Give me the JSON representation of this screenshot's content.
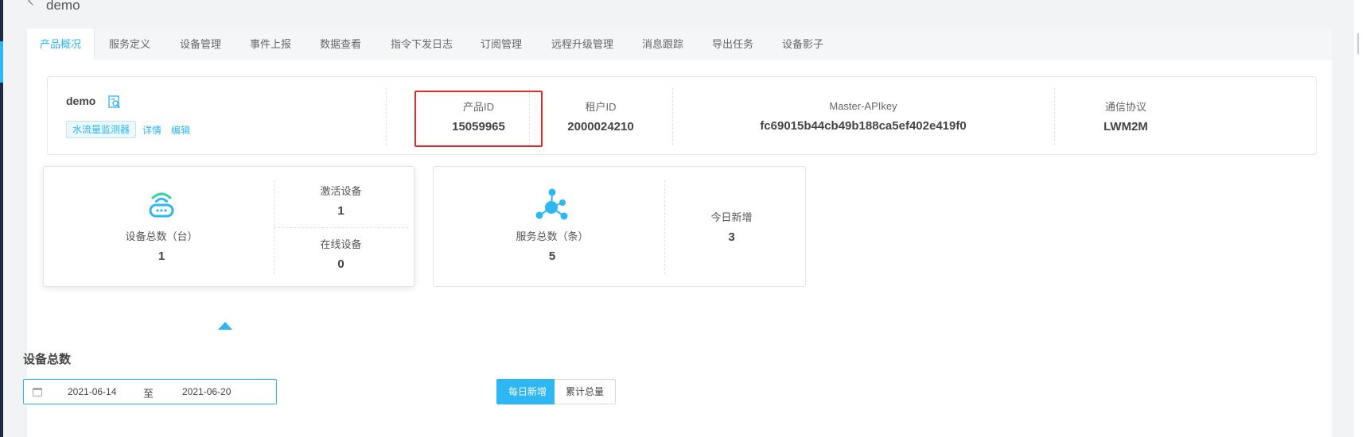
{
  "header": {
    "back_icon": "chevron-left-icon",
    "title": "demo"
  },
  "tabs": [
    {
      "label": "产品概况",
      "active": true
    },
    {
      "label": "服务定义"
    },
    {
      "label": "设备管理"
    },
    {
      "label": "事件上报"
    },
    {
      "label": "数据查看"
    },
    {
      "label": "指令下发日志"
    },
    {
      "label": "订阅管理"
    },
    {
      "label": "远程升级管理"
    },
    {
      "label": "消息跟踪"
    },
    {
      "label": "导出任务"
    },
    {
      "label": "设备影子"
    }
  ],
  "product": {
    "name": "demo",
    "name_icon": "document-search-icon",
    "tag": "水流量监测器",
    "detail_link": "详情",
    "edit_link": "编辑",
    "product_id_label": "产品ID",
    "product_id": "15059965",
    "tenant_id_label": "租户ID",
    "tenant_id": "2000024210",
    "apikey_label": "Master-APIkey",
    "apikey": "fc69015b44cb49b188ca5ef402e419f0",
    "protocol_label": "通信协议",
    "protocol": "LWM2M"
  },
  "device_card": {
    "icon": "router-wifi-icon",
    "total_label": "设备总数（台）",
    "total": "1",
    "activated_label": "激活设备",
    "activated": "1",
    "online_label": "在线设备",
    "online": "0"
  },
  "service_card": {
    "icon": "network-nodes-icon",
    "total_label": "服务总数（条）",
    "total": "5",
    "today_label": "今日新增",
    "today": "3"
  },
  "chart_section": {
    "title": "设备总数",
    "calendar_icon": "calendar-icon",
    "start_date": "2021-06-14",
    "separator": "至",
    "end_date": "2021-06-20",
    "daily_button": "每日新增",
    "cumulative_button": "累计总量"
  },
  "colors": {
    "accent": "#2db7f5",
    "highlight": "#e02a26"
  }
}
